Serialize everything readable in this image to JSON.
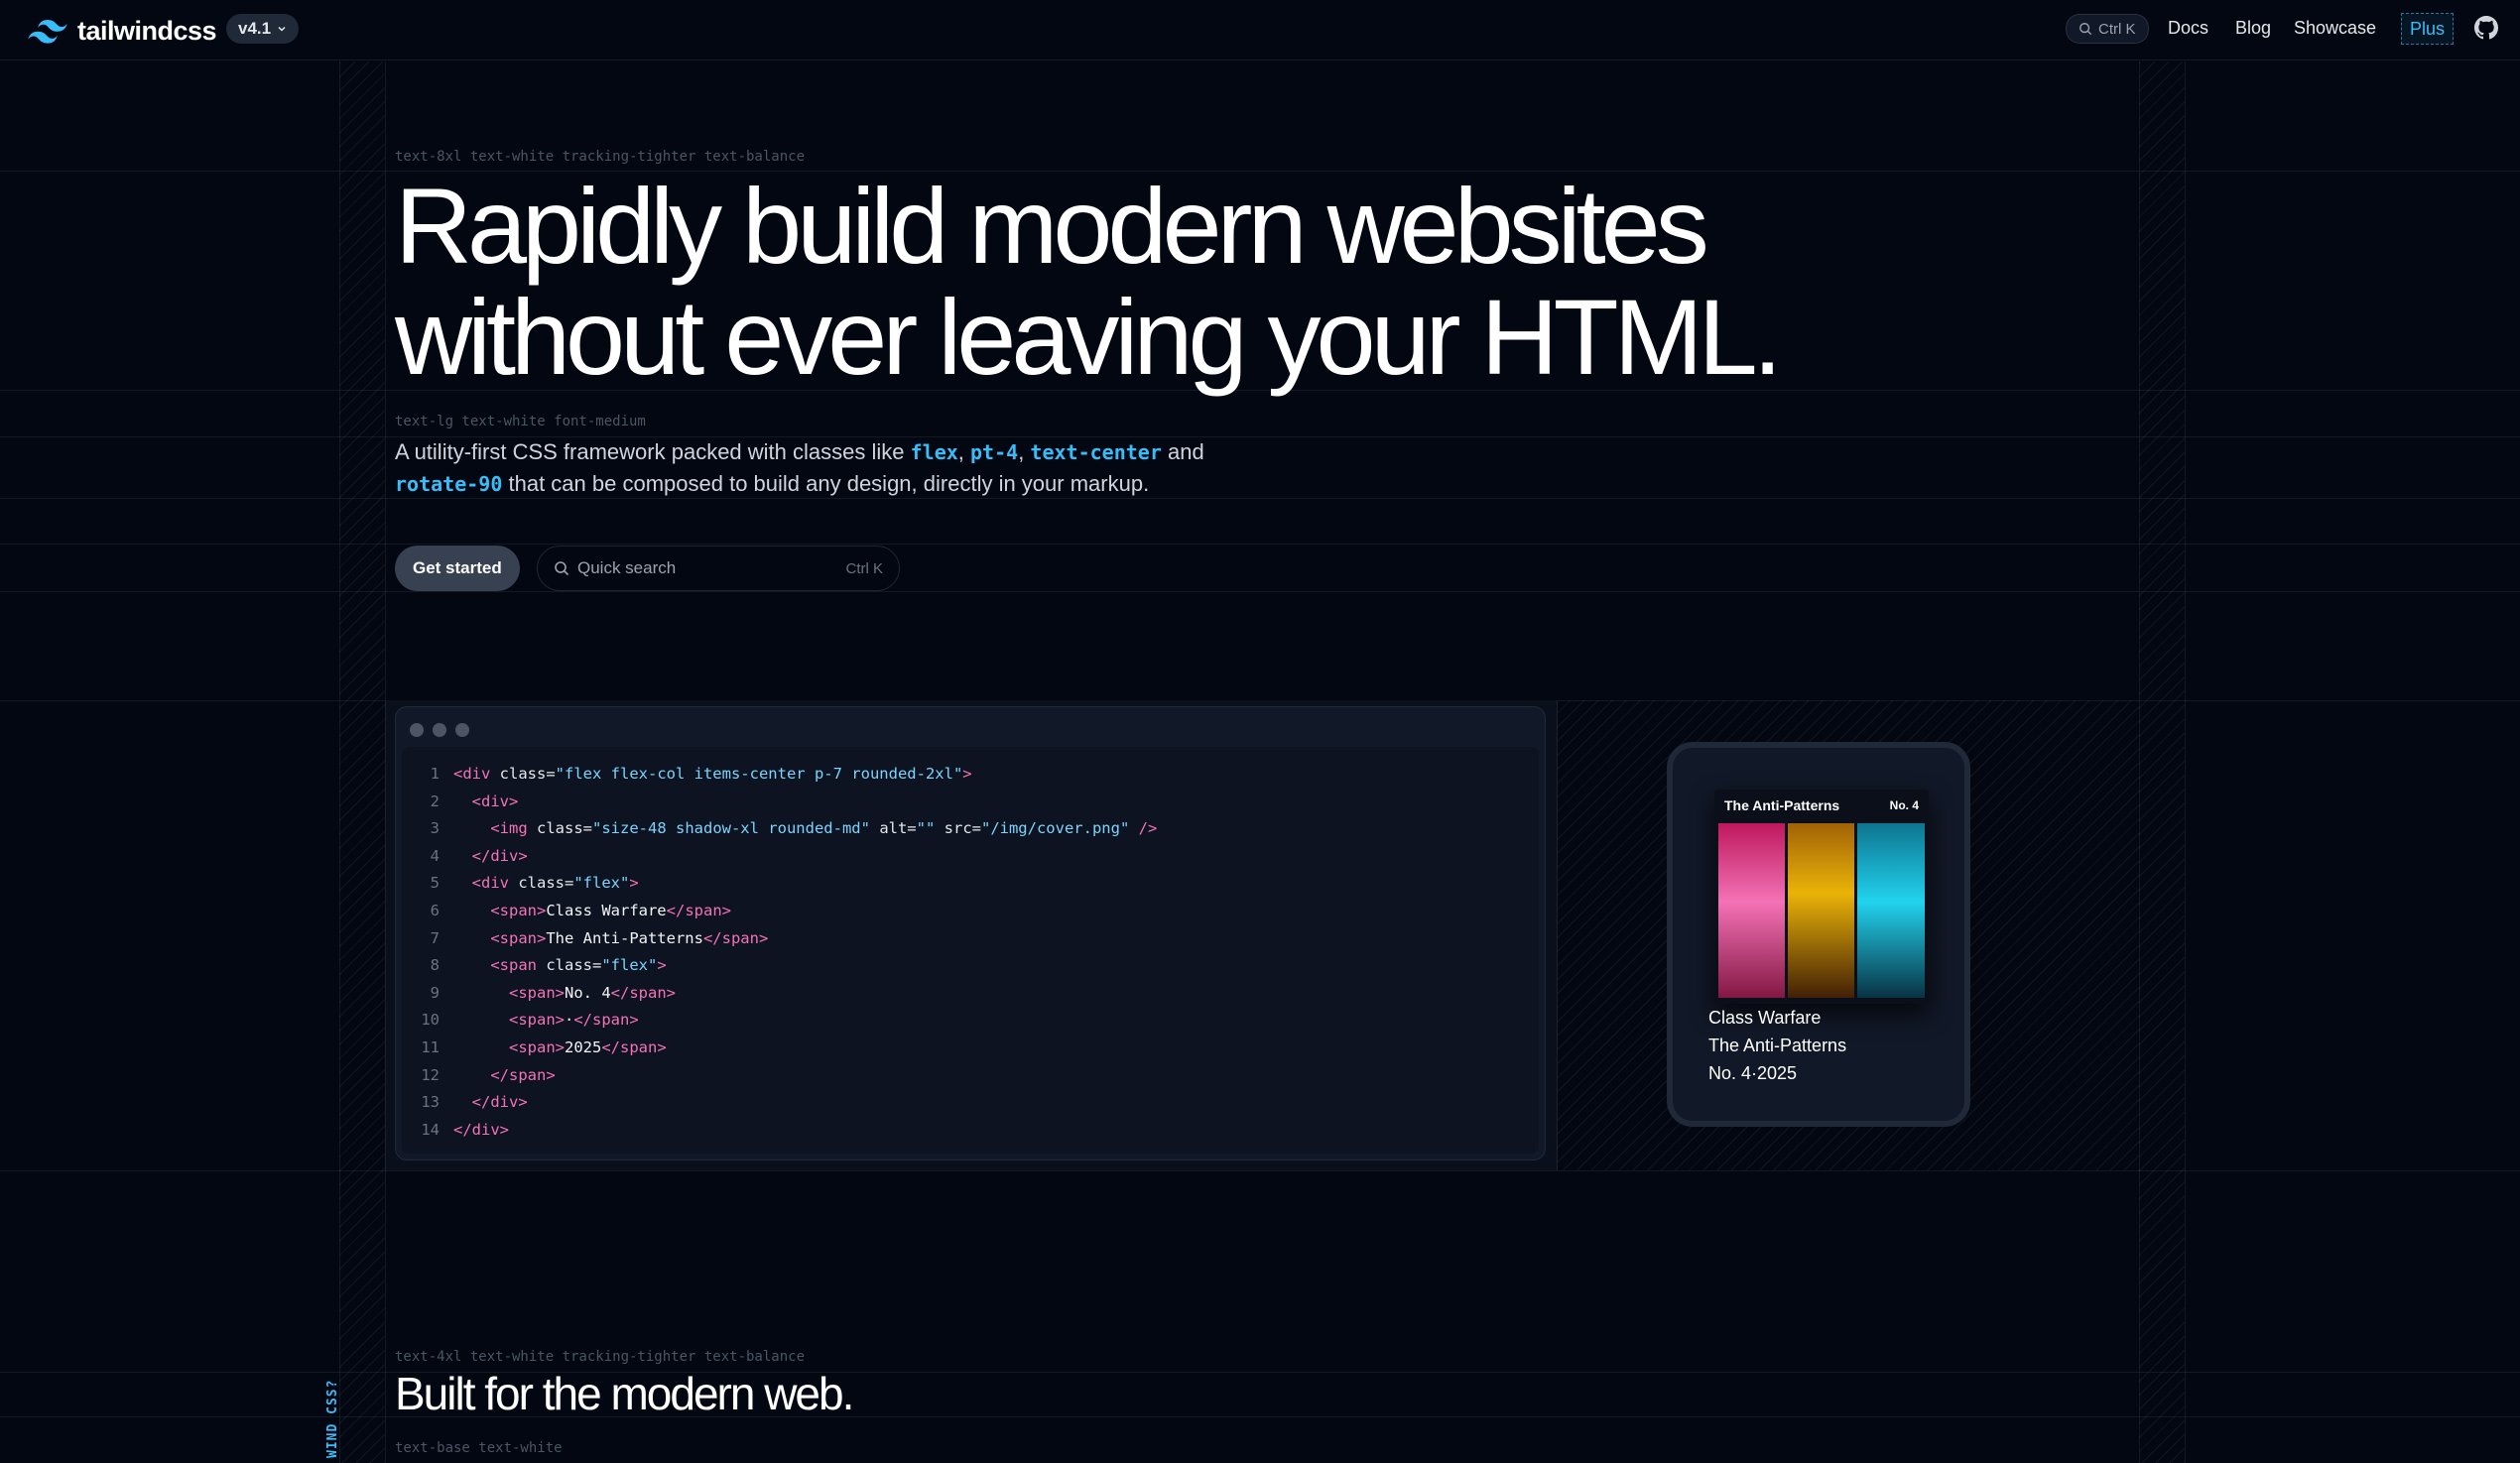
{
  "nav": {
    "brand": "tailwindcss",
    "version": "v4.1",
    "search_shortcut": "Ctrl K",
    "links": [
      "Docs",
      "Blog",
      "Showcase"
    ],
    "plus": "Plus"
  },
  "hero": {
    "title_label": "text-8xl text-white tracking-tighter text-balance",
    "title": "Rapidly build modern websites without ever leaving your HTML.",
    "subtitle_label": "text-lg text-white font-medium",
    "subtitle_parts": {
      "p1": "A utility-first CSS framework packed with classes like ",
      "c1": "flex",
      "p2": ", ",
      "c2": "pt-4",
      "p3": ", ",
      "c3": "text-center",
      "p4": " and ",
      "c4": "rotate-90",
      "p5": " that can be composed to build any design, directly in your markup."
    },
    "cta": "Get started",
    "search_placeholder": "Quick search",
    "search_kbd": "Ctrl K"
  },
  "code": {
    "lines": [
      "1",
      "2",
      "3",
      "4",
      "5",
      "6",
      "7",
      "8",
      "9",
      "10",
      "11",
      "12",
      "13",
      "14"
    ],
    "l1_class": "\"flex flex-col items-center p-7 rounded-2xl\"",
    "l3_class": "\"size-48 shadow-xl rounded-md\"",
    "l3_alt": "\"\"",
    "l3_src": "\"/img/cover.png\"",
    "l5_class": "\"flex\"",
    "l6_text": "Class Warfare",
    "l7_text": "The Anti-Patterns",
    "l8_class": "\"flex\"",
    "l9_text": "No. 4",
    "l10_text": "·",
    "l11_text": "2025"
  },
  "card": {
    "album_title": "The Anti-Patterns",
    "album_no": "No. 4",
    "line1": "Class Warfare",
    "line2": "The Anti-Patterns",
    "line3": "No. 4·2025"
  },
  "section": {
    "title_label": "text-4xl text-white tracking-tighter text-balance",
    "title": "Built for the modern web.",
    "body_label": "text-base text-white",
    "side_tag": "WIND CSS?"
  },
  "colors": {
    "background": "#030712",
    "accent": "#38bdf8",
    "tag": "#f472b6"
  }
}
